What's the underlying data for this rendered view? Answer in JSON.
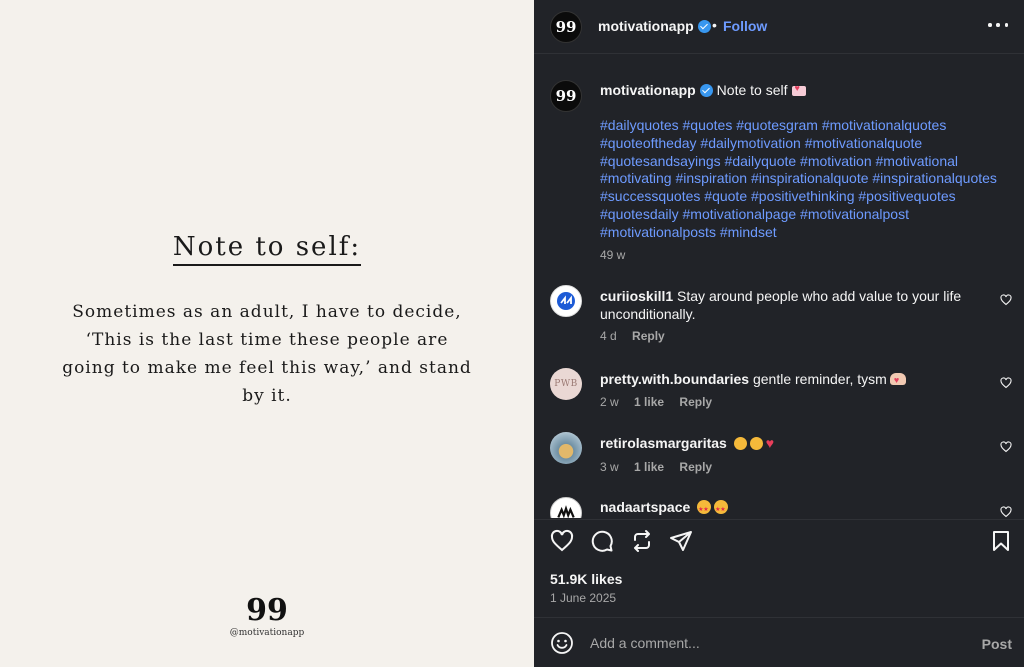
{
  "media": {
    "title": "Note to self:",
    "body": "Sometimes as an adult, I have to decide, ‘This is the last time these people are going to make me feel this way,’ and stand by it.",
    "quote_mark": "99",
    "handle": "@motivationapp"
  },
  "header": {
    "username": "motivationapp",
    "separator": "•",
    "follow_label": "Follow",
    "avatar_glyph": "99"
  },
  "caption": {
    "username": "motivationapp",
    "text": "Note to self",
    "hashtags": "#dailyquotes #quotes #quotesgram #motivationalquotes #quoteoftheday #dailymotivation #motivationalquote #quotesandsayings #dailyquote #motivation #motivational #motivating #inspiration #inspirationalquote #inspirationalquotes #successquotes #quote #positivethinking #positivequotes #quotesdaily #motivationalpage #motivationalpost #motivationalposts #mindset",
    "time": "49 w"
  },
  "comments": [
    {
      "username": "curiioskill1",
      "text": "Stay around people who add value to your life unconditionally.",
      "time": "4 d",
      "likes": "",
      "reply_label": "Reply",
      "avatar": "curiio-logo"
    },
    {
      "username": "pretty.with.boundaries",
      "text": "gentle reminder, tysm",
      "time": "2 w",
      "likes": "1 like",
      "reply_label": "Reply",
      "avatar_text": "PWB"
    },
    {
      "username": "retirolasmargaritas",
      "text": "",
      "time": "3 w",
      "likes": "1 like",
      "reply_label": "Reply",
      "avatar": "flower-photo"
    },
    {
      "username": "nadaartspace",
      "text": "",
      "avatar": "nada-logo"
    }
  ],
  "footer": {
    "likes": "51.9K likes",
    "date": "1 June 2025",
    "comment_placeholder": "Add a comment...",
    "post_label": "Post"
  },
  "colors": {
    "panel_bg": "#212328",
    "link_blue": "#6e9bff",
    "media_bg": "#f4f1ec",
    "verified": "#3897f0"
  }
}
